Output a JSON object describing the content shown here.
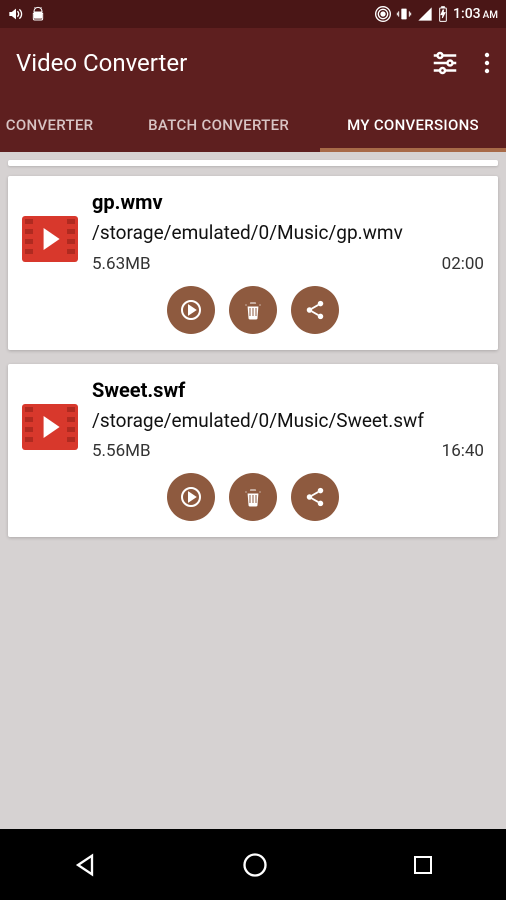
{
  "status": {
    "time": "1:03",
    "ampm": "AM"
  },
  "app": {
    "title": "Video Converter"
  },
  "tabs": [
    {
      "label": "CONVERTER",
      "active": false
    },
    {
      "label": "BATCH CONVERTER",
      "active": false
    },
    {
      "label": "MY CONVERSIONS",
      "active": true
    }
  ],
  "items": [
    {
      "name": "gp.wmv",
      "path": "/storage/emulated/0/Music/gp.wmv",
      "size": "5.63MB",
      "duration": "02:00"
    },
    {
      "name": "Sweet.swf",
      "path": "/storage/emulated/0/Music/Sweet.swf",
      "size": "5.56MB",
      "duration": "16:40"
    }
  ]
}
